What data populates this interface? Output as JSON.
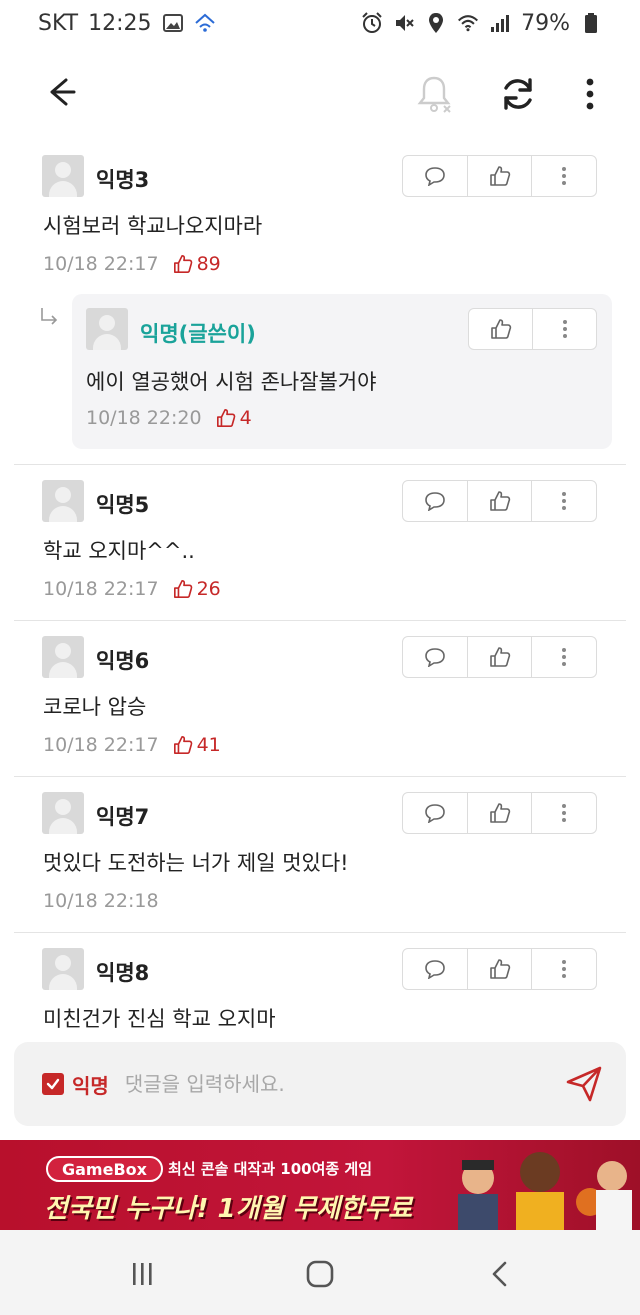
{
  "status_bar": {
    "carrier": "SKT",
    "time": "12:25",
    "battery": "79%"
  },
  "comments": [
    {
      "author": "익명3",
      "text": "시험보러 학교나오지마라",
      "time": "10/18 22:17",
      "likes": "89"
    },
    {
      "author": "익명(글쓴이)",
      "text": "에이 열공했어 시험 존나잘볼거야",
      "time": "10/18 22:20",
      "likes": "4",
      "is_reply": true
    },
    {
      "author": "익명5",
      "text": "학교 오지마^^..",
      "time": "10/18 22:17",
      "likes": "26"
    },
    {
      "author": "익명6",
      "text": "코로나 압승",
      "time": "10/18 22:17",
      "likes": "41"
    },
    {
      "author": "익명7",
      "text": "멋있다 도전하는 너가 제일 멋있다!",
      "time": "10/18 22:18",
      "likes": ""
    },
    {
      "author": "익명8",
      "text": "미친건가 진심 학교 오지마",
      "time": "",
      "likes": ""
    }
  ],
  "input_bar": {
    "anon_label": "익명",
    "anon_checked": true,
    "placeholder": "댓글을 입력하세요."
  },
  "ad": {
    "brand": "GameBox",
    "sub": "최신 콘솔 대작과 100여종 게임",
    "headline": "전국민 누구나! 1개월 무제한무료"
  },
  "colors": {
    "accent_red": "#c62828",
    "writer_teal": "#1aa39a",
    "ad_red": "#c2153a"
  },
  "icons": {
    "back": "arrow-left-icon",
    "bell": "bell-off-icon",
    "refresh": "refresh-icon",
    "more": "more-vertical-icon",
    "comment": "speech-bubble-icon",
    "like": "thumbs-up-icon",
    "send": "paper-plane-icon"
  }
}
